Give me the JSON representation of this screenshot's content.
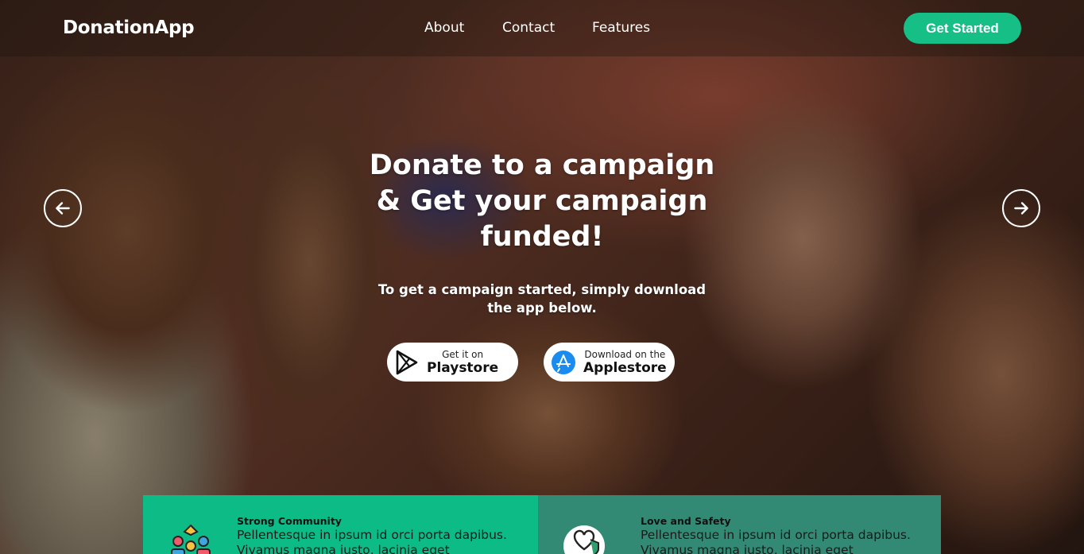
{
  "navbar": {
    "brand": "DonationApp",
    "links": [
      {
        "label": "About"
      },
      {
        "label": "Contact"
      },
      {
        "label": "Features"
      }
    ],
    "cta_label": "Get Started"
  },
  "hero": {
    "title_line1": "Donate to a campaign",
    "title_line2": "& Get your campaign",
    "title_line3": "funded!",
    "subtitle_line1": "To get a campaign started, simply download",
    "subtitle_line2": "the app below.",
    "prev_icon": "arrow-left-circle-icon",
    "next_icon": "arrow-right-circle-icon"
  },
  "stores": {
    "playstore": {
      "small": "Get it on",
      "big": "Playstore",
      "icon": "google-play-icon"
    },
    "applestore": {
      "small": "Download on the",
      "big": "Applestore",
      "icon": "app-store-icon"
    }
  },
  "features": [
    {
      "title": "Strong Community",
      "desc": "Pellentesque in ipsum id orci porta dapibus. Vivamus magna justo, lacinia eget consectetur",
      "icon": "community-icon",
      "bg": "#0dbb86"
    },
    {
      "title": "Love and Safety",
      "desc": "Pellentesque in ipsum id orci porta dapibus. Vivamus magna justo, lacinia eget consectetur",
      "icon": "heart-shield-icon",
      "bg": "#338a74"
    }
  ],
  "colors": {
    "accent": "#16bf86"
  }
}
